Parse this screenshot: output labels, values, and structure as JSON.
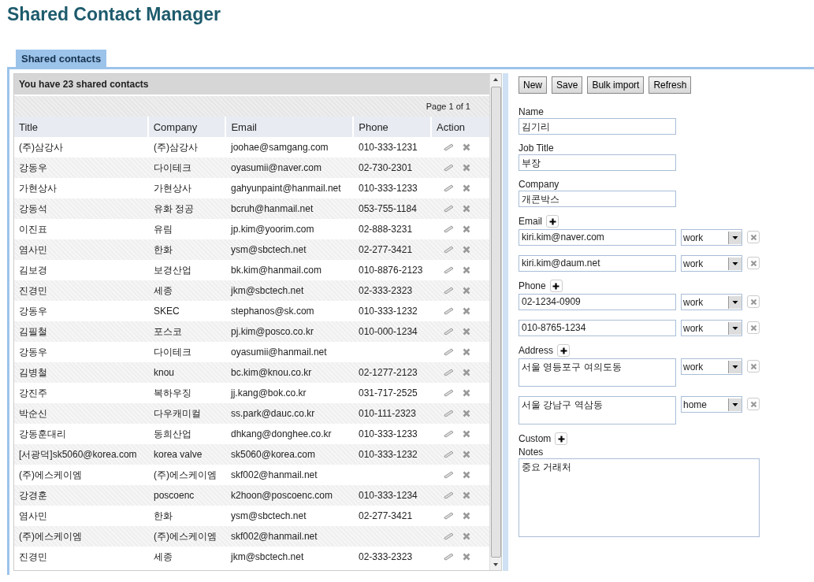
{
  "app_title": "Shared Contact Manager",
  "tabs": [
    {
      "label": "Shared contacts",
      "selected": true
    }
  ],
  "grid": {
    "summary": "You have 23 shared contacts",
    "pager": "Page 1 of 1",
    "columns": [
      "Title",
      "Company",
      "Email",
      "Phone",
      "Action"
    ],
    "rows": [
      {
        "title": "(주)삼강사",
        "company": "(주)삼강사",
        "email": "joohae@samgang.com",
        "phone": "010-333-1231"
      },
      {
        "title": "강동우",
        "company": "다이테크",
        "email": "oyasumii@naver.com",
        "phone": "02-730-2301"
      },
      {
        "title": "가현상사",
        "company": "가현상사",
        "email": "gahyunpaint@hanmail.net",
        "phone": "010-333-1233"
      },
      {
        "title": "강동석",
        "company": "유화 정공",
        "email": "bcruh@hanmail.net",
        "phone": "053-755-1184"
      },
      {
        "title": "이진표",
        "company": "유림",
        "email": "jp.kim@yoorim.com",
        "phone": "02-888-3231"
      },
      {
        "title": "염사민",
        "company": "한화",
        "email": "ysm@sbctech.net",
        "phone": "02-277-3421"
      },
      {
        "title": "김보경",
        "company": "보경산업",
        "email": "bk.kim@hanmail.com",
        "phone": "010-8876-2123"
      },
      {
        "title": "진경민",
        "company": "세종",
        "email": "jkm@sbctech.net",
        "phone": "02-333-2323"
      },
      {
        "title": "강동우",
        "company": "SKEC",
        "email": "stephanos@sk.com",
        "phone": "010-333-1232"
      },
      {
        "title": "김필철",
        "company": "포스코",
        "email": "pj.kim@posco.co.kr",
        "phone": "010-000-1234"
      },
      {
        "title": "강동우",
        "company": "다이테크",
        "email": "oyasumii@hanmail.net"
      },
      {
        "title": "김병철",
        "company": "knou",
        "email": "bc.kim@knou.co.kr",
        "phone": "02-1277-2123"
      },
      {
        "title": "강진주",
        "company": "복하우징",
        "email": "jj.kang@bok.co.kr",
        "phone": "031-717-2525"
      },
      {
        "title": "박순신",
        "company": "다우캐미컬",
        "email": "ss.park@dauc.co.kr",
        "phone": "010-111-2323"
      },
      {
        "title": "강동훈대리",
        "company": "동희산업",
        "email": "dhkang@donghee.co.kr",
        "phone": "010-333-1233"
      },
      {
        "title": "[서광덕]sk5060@korea.com",
        "company": "korea valve",
        "email": "sk5060@korea.com",
        "phone": "010-333-1232"
      },
      {
        "title": "(주)에스케이엠",
        "company": "(주)에스케이엠",
        "email": "skf002@hanmail.net"
      },
      {
        "title": "강경훈",
        "company": "poscoenc",
        "email": "k2hoon@poscoenc.com",
        "phone": "010-333-1234"
      },
      {
        "title": "염사민",
        "company": "한화",
        "email": "ysm@sbctech.net",
        "phone": "02-277-3421"
      },
      {
        "title": "(주)에스케이엠",
        "company": "(주)에스케이엠",
        "email": "skf002@hanmail.net"
      },
      {
        "title": "진경민",
        "company": "세종",
        "email": "jkm@sbctech.net",
        "phone": "02-333-2323"
      }
    ]
  },
  "toolbar": [
    "New",
    "Save",
    "Bulk import",
    "Refresh"
  ],
  "form": [
    {
      "kind": "text",
      "label": "Name",
      "value": "김기리"
    },
    {
      "kind": "text",
      "label": "Job Title",
      "value": "부장"
    },
    {
      "kind": "text",
      "label": "Company",
      "value": "개콘박스"
    },
    {
      "kind": "list",
      "label": "Email",
      "entries": [
        {
          "value": "kiri.kim@naver.com",
          "type": "work"
        },
        {
          "value": "kiri.kim@daum.net",
          "type": "work"
        }
      ]
    },
    {
      "kind": "list",
      "label": "Phone",
      "entries": [
        {
          "value": "02-1234-0909",
          "type": "work"
        },
        {
          "value": "010-8765-1234",
          "type": "work"
        }
      ]
    },
    {
      "kind": "area-list",
      "label": "Address",
      "entries": [
        {
          "value": "서울 영등포구 여의도동",
          "type": "work"
        },
        {
          "value": "서울 강남구 역삼동",
          "type": "home"
        }
      ]
    },
    {
      "kind": "add-only",
      "label": "Custom"
    },
    {
      "kind": "notes",
      "label": "Notes",
      "value": "중요 거래처"
    }
  ]
}
